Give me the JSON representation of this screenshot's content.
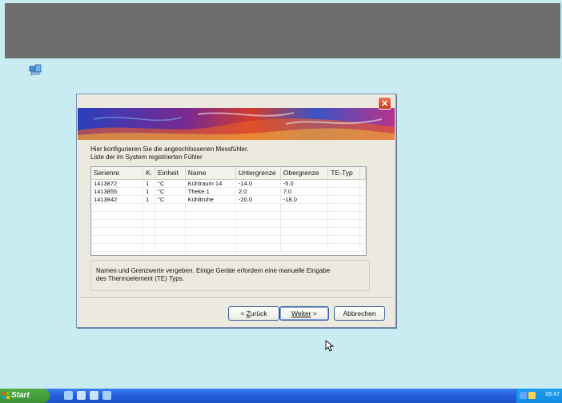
{
  "dialog": {
    "close_label": "×",
    "intro_line1": "Hier konfigurieren Sie die angeschlossenen Messfühler.",
    "intro_line2": "Liste der im System registrierten Fühler",
    "columns": [
      "Seriennr.",
      "K.",
      "Einheit",
      "Name",
      "Untergrenze",
      "Obergrenze",
      "TE-Typ"
    ],
    "rows": [
      [
        "1413872",
        "1",
        "°C",
        "Kühlraum 14",
        "-14.0",
        "-5.0",
        ""
      ],
      [
        "1413855",
        "1",
        "°C",
        "Theke 1",
        "2.0",
        "7.0",
        ""
      ],
      [
        "1413842",
        "1",
        "°C",
        "Kühltruhe",
        "-20.0",
        "-18.0",
        ""
      ],
      [
        "",
        "",
        "",
        "",
        "",
        "",
        ""
      ],
      [
        "",
        "",
        "",
        "",
        "",
        "",
        ""
      ],
      [
        "",
        "",
        "",
        "",
        "",
        "",
        ""
      ],
      [
        "",
        "",
        "",
        "",
        "",
        "",
        ""
      ],
      [
        "",
        "",
        "",
        "",
        "",
        "",
        ""
      ],
      [
        "",
        "",
        "",
        "",
        "",
        "",
        ""
      ]
    ],
    "info_line1": "Namen und Grenzwerte vergeben. Einige Geräte erfordern eine manuelle Eingabe",
    "info_line2": "des Thermoelement (TE) Typs.",
    "back_button": {
      "prefix": "< ",
      "accel": "Z",
      "rest": "urück"
    },
    "next_button": {
      "accel": "W",
      "rest": "eiter",
      "suffix": " >"
    },
    "cancel_button": "Abbrechen"
  },
  "taskbar": {
    "start_label": "Start",
    "clock": "05:47"
  },
  "icons": {
    "desktop": "network-computer-icon",
    "close": "close-icon",
    "cursor": "mouse-cursor-icon"
  },
  "colors": {
    "desktop_bg": "#c9ecf3",
    "top_bar": "#6d6d6d",
    "taskbar": "#245edb",
    "start_button": "#3a8f32",
    "close_button": "#c8391b"
  }
}
